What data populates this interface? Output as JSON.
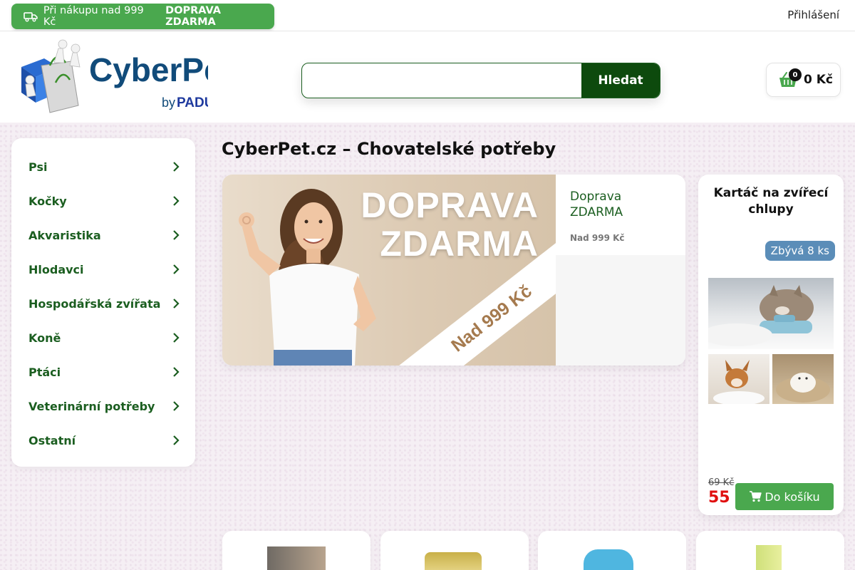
{
  "topbar": {
    "promo_prefix": "Při nákupu nad 999 Kč",
    "promo_strong": "DOPRAVA ZDARMA",
    "login": "Přihlášení"
  },
  "header": {
    "logo_main": "CyberPet",
    "logo_by": "by",
    "logo_brand": "PADU",
    "search_placeholder": "",
    "search_button": "Hledat",
    "cart_count": "0",
    "cart_total": "0 Kč"
  },
  "sidebar": {
    "items": [
      {
        "label": "Psi"
      },
      {
        "label": "Kočky"
      },
      {
        "label": "Akvaristika"
      },
      {
        "label": "Hlodavci"
      },
      {
        "label": "Hospodářská zvířata"
      },
      {
        "label": "Koně"
      },
      {
        "label": "Ptáci"
      },
      {
        "label": "Veterinární potřeby"
      },
      {
        "label": "Ostatní"
      }
    ]
  },
  "main": {
    "title": "CyberPet.cz – Chovatelské potřeby",
    "banner": {
      "line1": "DOPRAVA",
      "line2": "ZDARMA",
      "ribbon": "Nad 999 Kč",
      "side_head": "Doprava ZDARMA",
      "side_sub": "Nad 999 Kč"
    }
  },
  "product": {
    "name": "Kartáč na zvířecí chlupy",
    "stock": "Zbývá 8 ks",
    "old_price": "69 Kč",
    "price": "55 Kč",
    "buy_label": "Do košíku"
  },
  "colors": {
    "brand_green": "#4aa84e",
    "dark_green": "#0d4a0d",
    "category_green": "#1b5e20",
    "price_red": "#e01010",
    "stock_blue": "#5b8db8"
  }
}
